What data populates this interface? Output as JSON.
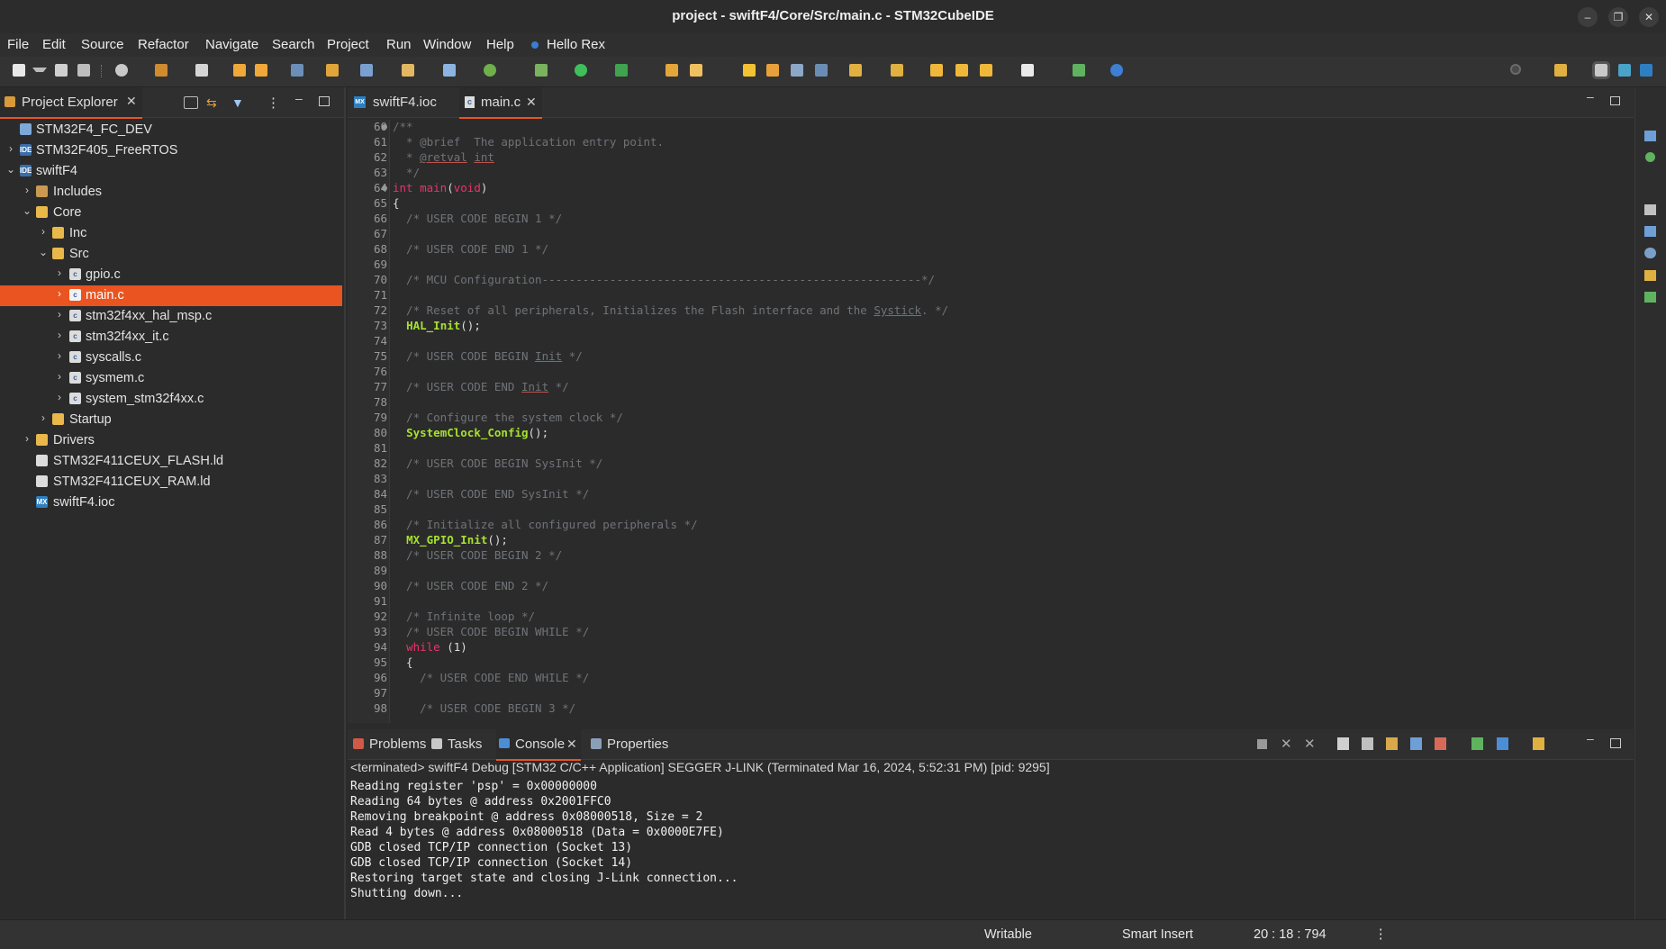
{
  "window": {
    "title": "project - swiftF4/Core/Src/main.c - STM32CubeIDE",
    "controls": {
      "minimize": "–",
      "restore": "❐",
      "close": "✕"
    }
  },
  "menu": [
    "File",
    "Edit",
    "Source",
    "Refactor",
    "Navigate",
    "Search",
    "Project",
    "Run",
    "Window",
    "Help"
  ],
  "menu_extra": "Hello Rex",
  "explorer": {
    "title": "Project Explorer",
    "tree": [
      {
        "label": "STM32F4_FC_DEV"
      },
      {
        "label": "STM32F405_FreeRTOS"
      },
      {
        "label": "swiftF4"
      },
      {
        "label": "Includes"
      },
      {
        "label": "Core"
      },
      {
        "label": "Inc"
      },
      {
        "label": "Src"
      },
      {
        "label": "gpio.c"
      },
      {
        "label": "main.c"
      },
      {
        "label": "stm32f4xx_hal_msp.c"
      },
      {
        "label": "stm32f4xx_it.c"
      },
      {
        "label": "syscalls.c"
      },
      {
        "label": "sysmem.c"
      },
      {
        "label": "system_stm32f4xx.c"
      },
      {
        "label": "Startup"
      },
      {
        "label": "Drivers"
      },
      {
        "label": "STM32F411CEUX_FLASH.ld"
      },
      {
        "label": "STM32F411CEUX_RAM.ld"
      },
      {
        "label": "swiftF4.ioc"
      }
    ]
  },
  "editor": {
    "tabs": [
      {
        "label": "swiftF4.ioc",
        "icon": "MX"
      },
      {
        "label": "main.c"
      }
    ],
    "lines": [
      {
        "n": "60",
        "segs": [
          {
            "t": "/**",
            "c": "cm"
          }
        ]
      },
      {
        "n": "61",
        "segs": [
          {
            "t": "  * @brief  The application entry point.",
            "c": "cm"
          }
        ]
      },
      {
        "n": "62",
        "segs": [
          {
            "t": "  * ",
            "c": "cm"
          },
          {
            "t": "@retval",
            "c": "cm ul"
          },
          {
            "t": " ",
            "c": "cm"
          },
          {
            "t": "int",
            "c": "cm ul"
          }
        ]
      },
      {
        "n": "63",
        "segs": [
          {
            "t": "  */",
            "c": "cm"
          }
        ]
      },
      {
        "n": "64",
        "segs": [
          {
            "t": "int",
            "c": "kw"
          },
          {
            "t": " "
          },
          {
            "t": "main",
            "c": "kw"
          },
          {
            "t": "("
          },
          {
            "t": "void",
            "c": "kw"
          },
          {
            "t": ")"
          }
        ]
      },
      {
        "n": "65",
        "segs": [
          {
            "t": "{"
          }
        ]
      },
      {
        "n": "66",
        "segs": [
          {
            "t": "  /* USER CODE BEGIN 1 */",
            "c": "cm"
          }
        ]
      },
      {
        "n": "67",
        "segs": []
      },
      {
        "n": "68",
        "segs": [
          {
            "t": "  /* USER CODE END 1 */",
            "c": "cm"
          }
        ]
      },
      {
        "n": "69",
        "segs": []
      },
      {
        "n": "70",
        "segs": [
          {
            "t": "  /* MCU Configuration--------------------------------------------------------*/",
            "c": "cm"
          }
        ]
      },
      {
        "n": "71",
        "segs": []
      },
      {
        "n": "72",
        "segs": [
          {
            "t": "  /* Reset of all peripherals, Initializes the Flash interface and the ",
            "c": "cm"
          },
          {
            "t": "Systick",
            "c": "cm ul"
          },
          {
            "t": ". */",
            "c": "cm"
          }
        ]
      },
      {
        "n": "73",
        "segs": [
          {
            "t": "  "
          },
          {
            "t": "HAL_Init",
            "c": "fn"
          },
          {
            "t": "();"
          }
        ]
      },
      {
        "n": "74",
        "segs": []
      },
      {
        "n": "75",
        "segs": [
          {
            "t": "  /* USER CODE BEGIN ",
            "c": "cm"
          },
          {
            "t": "Init",
            "c": "cm ul"
          },
          {
            "t": " */",
            "c": "cm"
          }
        ]
      },
      {
        "n": "76",
        "segs": []
      },
      {
        "n": "77",
        "segs": [
          {
            "t": "  /* USER CODE END ",
            "c": "cm"
          },
          {
            "t": "Init",
            "c": "cm ul"
          },
          {
            "t": " */",
            "c": "cm"
          }
        ]
      },
      {
        "n": "78",
        "segs": []
      },
      {
        "n": "79",
        "segs": [
          {
            "t": "  /* Configure the system clock */",
            "c": "cm"
          }
        ]
      },
      {
        "n": "80",
        "segs": [
          {
            "t": "  "
          },
          {
            "t": "SystemClock_Config",
            "c": "fn"
          },
          {
            "t": "();"
          }
        ]
      },
      {
        "n": "81",
        "segs": []
      },
      {
        "n": "82",
        "segs": [
          {
            "t": "  /* USER CODE BEGIN SysInit */",
            "c": "cm"
          }
        ]
      },
      {
        "n": "83",
        "segs": []
      },
      {
        "n": "84",
        "segs": [
          {
            "t": "  /* USER CODE END SysInit */",
            "c": "cm"
          }
        ]
      },
      {
        "n": "85",
        "segs": []
      },
      {
        "n": "86",
        "segs": [
          {
            "t": "  /* Initialize all configured peripherals */",
            "c": "cm"
          }
        ]
      },
      {
        "n": "87",
        "segs": [
          {
            "t": "  "
          },
          {
            "t": "MX_GPIO_Init",
            "c": "fn"
          },
          {
            "t": "();"
          }
        ]
      },
      {
        "n": "88",
        "segs": [
          {
            "t": "  /* USER CODE BEGIN 2 */",
            "c": "cm"
          }
        ]
      },
      {
        "n": "89",
        "segs": []
      },
      {
        "n": "90",
        "segs": [
          {
            "t": "  /* USER CODE END 2 */",
            "c": "cm"
          }
        ]
      },
      {
        "n": "91",
        "segs": []
      },
      {
        "n": "92",
        "segs": [
          {
            "t": "  /* Infinite loop */",
            "c": "cm"
          }
        ]
      },
      {
        "n": "93",
        "segs": [
          {
            "t": "  /* USER CODE BEGIN WHILE */",
            "c": "cm"
          }
        ]
      },
      {
        "n": "94",
        "segs": [
          {
            "t": "  "
          },
          {
            "t": "while",
            "c": "kw"
          },
          {
            "t": " (1)"
          }
        ]
      },
      {
        "n": "95",
        "segs": [
          {
            "t": "  {"
          }
        ]
      },
      {
        "n": "96",
        "segs": [
          {
            "t": "    /* USER CODE END WHILE */",
            "c": "cm"
          }
        ]
      },
      {
        "n": "97",
        "segs": []
      },
      {
        "n": "98",
        "segs": [
          {
            "t": "    /* USER CODE BEGIN 3 */",
            "c": "cm"
          }
        ]
      }
    ]
  },
  "console": {
    "tabs": [
      "Problems",
      "Tasks",
      "Console",
      "Properties"
    ],
    "header": "<terminated> swiftF4 Debug [STM32 C/C++ Application] SEGGER J-LINK (Terminated Mar 16, 2024, 5:52:31 PM) [pid: 9295]",
    "lines": [
      "Reading register 'psp' = 0x00000000",
      "Reading 64 bytes @ address 0x2001FFC0",
      "Removing breakpoint @ address 0x08000518, Size = 2",
      "Read 4 bytes @ address 0x08000518 (Data = 0x0000E7FE)",
      "GDB closed TCP/IP connection (Socket 13)",
      "GDB closed TCP/IP connection (Socket 14)",
      "Restoring target state and closing J-Link connection...",
      "Shutting down..."
    ]
  },
  "status": {
    "mode": "Writable",
    "insert": "Smart Insert",
    "position": "20 : 18 : 794"
  },
  "colors": {
    "accent": "#e95420",
    "keyword": "#e8346b",
    "function": "#a6e22e",
    "comment": "#6f7378"
  }
}
